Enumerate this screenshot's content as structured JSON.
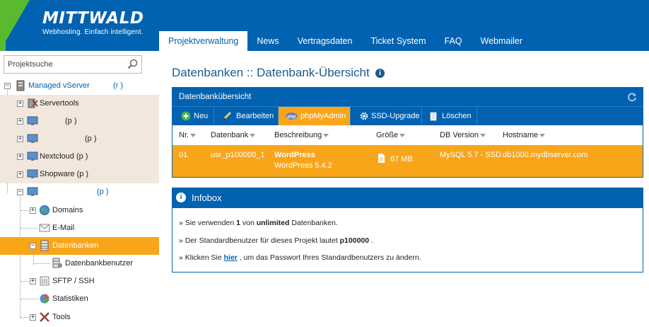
{
  "brand": {
    "name": "MITTWALD",
    "tagline": "Webhosting. Einfach intelligent."
  },
  "topnav": [
    {
      "label": "Projektverwaltung",
      "active": true
    },
    {
      "label": "News"
    },
    {
      "label": "Vertragsdaten"
    },
    {
      "label": "Ticket System"
    },
    {
      "label": "FAQ"
    },
    {
      "label": "Webmailer"
    }
  ],
  "sidebar": {
    "search_placeholder": "Projektsuche",
    "tree": [
      {
        "label": "Managed vServer",
        "extra": "(r        )",
        "icon": "server-icon"
      },
      {
        "label": "Servertools",
        "icon": "servertools-icon"
      },
      {
        "label": "",
        "extra": "(p          )",
        "icon": "monitor-icon"
      },
      {
        "label": "",
        "extra": "(p          )",
        "icon": "monitor-icon"
      },
      {
        "label": "Nextcloud (p          )",
        "icon": "monitor-icon"
      },
      {
        "label": "Shopware (p          )",
        "icon": "monitor-icon"
      },
      {
        "label": "",
        "extra": "(p          )",
        "icon": "monitor-icon"
      },
      {
        "label": "Domains",
        "icon": "globe-icon"
      },
      {
        "label": "E-Mail",
        "icon": "mail-icon"
      },
      {
        "label": "Datenbanken",
        "icon": "database-icon",
        "selected": true
      },
      {
        "label": "Datenbankbenutzer",
        "icon": "database-user-icon"
      },
      {
        "label": "SFTP / SSH",
        "icon": "sftp-icon"
      },
      {
        "label": "Statistiken",
        "icon": "pie-chart-icon"
      },
      {
        "label": "Tools",
        "icon": "tools-icon"
      }
    ]
  },
  "main": {
    "title": "Datenbanken :: Datenbank-Übersicht",
    "panel_title": "Datenbankübersicht",
    "toolbar": [
      {
        "label": "Neu",
        "icon": "plus-icon"
      },
      {
        "label": "Bearbeiten",
        "icon": "pencil-icon"
      },
      {
        "label": "phpMyAdmin",
        "icon": "php-icon",
        "active": true
      },
      {
        "label": "SSD-Upgrade",
        "icon": "gear-icon"
      },
      {
        "label": "Löschen",
        "icon": "trash-icon"
      }
    ],
    "columns": [
      "Nr.",
      "Datenbank",
      "Beschreibung",
      "Größe",
      "DB Version",
      "Hostname"
    ],
    "rows": [
      {
        "nr": "01",
        "datenbank": "usr_p100000_1",
        "beschreibung_title": "WordPress",
        "beschreibung_sub": "WordPress 5.4.2",
        "groesse": "67 MB",
        "db_version": "MySQL 5.7 - SSD",
        "hostname": "db1000.mydbserver.com"
      }
    ],
    "infobox": {
      "title": "Infobox",
      "line1": {
        "prefix": "» Sie verwenden ",
        "count": "1",
        "mid": " von ",
        "limit": "unlimited",
        "suffix": " Datenbanken."
      },
      "line2": {
        "prefix": "» Der Standardbenutzer für dieses Projekt lautet ",
        "user": "p100000",
        "suffix": " ."
      },
      "line3": {
        "prefix": "» Klicken Sie ",
        "link": "hier",
        "suffix": " , um das Passwort Ihres Standardbenutzers zu ändern."
      }
    }
  },
  "colors": {
    "brand_blue": "#0062b0",
    "brand_green": "#5aba2f",
    "accent_orange": "#f9a51a",
    "tree_shade": "#f2e7dc"
  }
}
